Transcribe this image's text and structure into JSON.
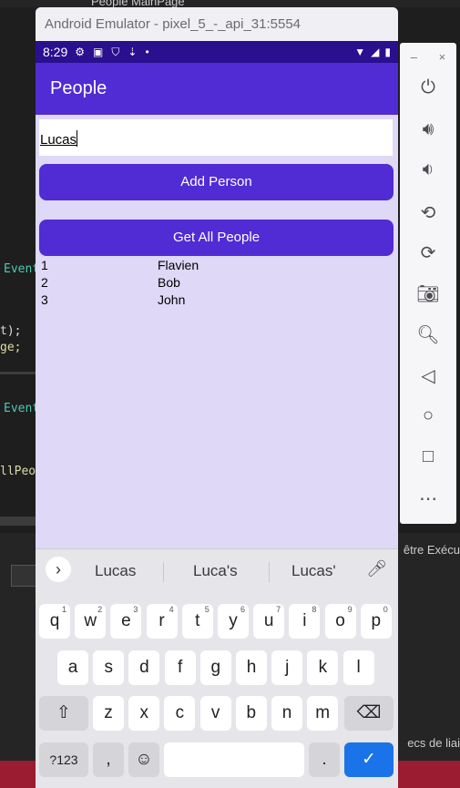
{
  "ide": {
    "tab_text": "People MainPage",
    "code_lines": [
      "Event",
      "t);",
      "ge;",
      "Event",
      "llPeop"
    ],
    "right_texts": [
      "être Exécu",
      "ecs de liai"
    ]
  },
  "emulator": {
    "title": "Android Emulator - pixel_5_-_api_31:5554",
    "status": {
      "time": "8:29"
    },
    "app_title": "People",
    "entry_value": "Lucas",
    "add_button": "Add Person",
    "get_button": "Get All People",
    "people": [
      {
        "id": "1",
        "name": "Flavien"
      },
      {
        "id": "2",
        "name": "Bob"
      },
      {
        "id": "3",
        "name": "John"
      }
    ],
    "keyboard": {
      "suggestions": [
        "Lucas",
        "Luca's",
        "Lucas'"
      ],
      "row1": [
        "q",
        "w",
        "e",
        "r",
        "t",
        "y",
        "u",
        "i",
        "o",
        "p"
      ],
      "row1_digits": [
        "1",
        "2",
        "3",
        "4",
        "5",
        "6",
        "7",
        "8",
        "9",
        "0"
      ],
      "row2": [
        "a",
        "s",
        "d",
        "f",
        "g",
        "h",
        "j",
        "k",
        "l"
      ],
      "row3": [
        "z",
        "x",
        "c",
        "v",
        "b",
        "n",
        "m"
      ],
      "mode_key": "?123",
      "comma": ",",
      "period": "."
    }
  },
  "side_panel": {
    "minimize": "–",
    "close": "×",
    "controls": [
      "power-icon",
      "volume-up-icon",
      "volume-down-icon",
      "rotate-left-icon",
      "rotate-right-icon",
      "camera-icon",
      "zoom-icon",
      "back-icon",
      "home-icon",
      "overview-icon",
      "more-icon"
    ]
  }
}
